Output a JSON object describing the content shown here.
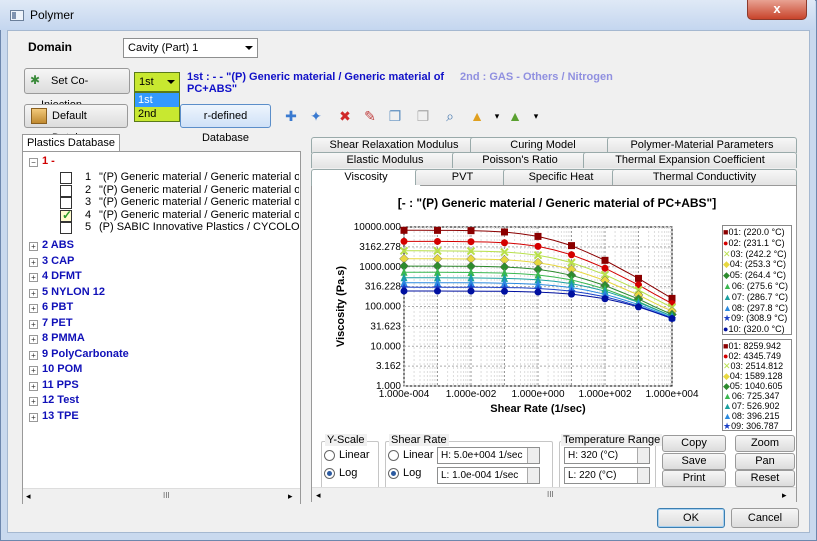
{
  "window": {
    "title": "Polymer",
    "close": "x"
  },
  "domain": {
    "label": "Domain",
    "value": "Cavity (Part) 1"
  },
  "coinj": {
    "button": "Set Co-Injection",
    "selected": "1st",
    "options": [
      "1st",
      "2nd"
    ],
    "first": "1st : - - \"(P)  Generic material / Generic material of",
    "first2": "PC+ABS\"",
    "second": "2nd : GAS - Others / Nitrogen"
  },
  "toolbar": {
    "default_db": "Default Database",
    "user_db": "r-defined Database"
  },
  "plastics": {
    "tab": "Plastics Database",
    "root": "1  -",
    "items": [
      {
        "n": "1",
        "t": "\"(P)  Generic material / Generic material of",
        "checked": false
      },
      {
        "n": "2",
        "t": "\"(P)  Generic material / Generic material of",
        "checked": false
      },
      {
        "n": "3",
        "t": "\"(P)  Generic material / Generic material of",
        "checked": false
      },
      {
        "n": "4",
        "t": "\"(P)  Generic material / Generic material of",
        "checked": true
      },
      {
        "n": "5",
        "t": "(P)  SABIC Innovative Plastics / CYCOLOY",
        "checked": false
      }
    ],
    "groups": [
      "2  ABS",
      "3  CAP",
      "4  DFMT",
      "5  NYLON 12",
      "6  PBT",
      "7  PET",
      "8  PMMA",
      "9  PolyCarbonate",
      "10  POM",
      "11  PPS",
      "12  Test",
      "13  TPE"
    ]
  },
  "tabs": {
    "row1": [
      "Shear Relaxation Modulus",
      "Curing Model",
      "Polymer-Material Parameters"
    ],
    "row2": [
      "Elastic Modulus",
      "Poisson's Ratio",
      "Thermal Expansion Coefficient"
    ],
    "row3": [
      "Viscosity",
      "PVT",
      "Specific Heat",
      "Thermal Conductivity"
    ]
  },
  "chart_data": {
    "type": "line",
    "title": "[- : \"(P)  Generic material / Generic material of PC+ABS\"]",
    "xlabel": "Shear Rate (1/sec)",
    "ylabel": "Viscosity (Pa.s)",
    "xscale": "log",
    "yscale": "log",
    "xlim": [
      0.0001,
      10000
    ],
    "ylim": [
      1,
      10000
    ],
    "xticks": [
      "1.000e-004",
      "1.000e-002",
      "1.000e+000",
      "1.000e+002",
      "1.000e+004"
    ],
    "yticks": [
      "10000.000",
      "3162.278",
      "1000.000",
      "316.228",
      "100.000",
      "31.623",
      "10.000",
      "3.162",
      "1.000"
    ],
    "x": [
      0.0001,
      0.0003,
      0.001,
      0.003,
      0.01,
      0.03,
      0.1,
      0.3,
      1,
      3,
      10,
      30,
      100,
      300,
      1000,
      3000,
      10000
    ],
    "series": [
      {
        "name": "01: (220.0 °C)",
        "color": "#8b0000",
        "marker": "square",
        "values": [
          8259.9,
          8250,
          8230,
          8190,
          8100,
          7900,
          7500,
          6800,
          5800,
          4600,
          3400,
          2300,
          1450,
          880,
          510,
          290,
          160
        ]
      },
      {
        "name": "02: (231.1 °C)",
        "color": "#d40000",
        "marker": "circle",
        "values": [
          4345.7,
          4340,
          4330,
          4310,
          4270,
          4190,
          4020,
          3720,
          3250,
          2650,
          2000,
          1400,
          920,
          580,
          350,
          205,
          118
        ]
      },
      {
        "name": "03: (242.2 °C)",
        "color": "#b8e04a",
        "marker": "x",
        "values": [
          2514.8,
          2512,
          2507,
          2497,
          2476,
          2432,
          2345,
          2190,
          1950,
          1630,
          1270,
          920,
          630,
          410,
          260,
          158,
          95
        ]
      },
      {
        "name": "04: (253.3 °C)",
        "color": "#e8d840",
        "marker": "diamond",
        "values": [
          1589.1,
          1588,
          1585,
          1579,
          1567,
          1542,
          1492,
          1403,
          1266,
          1080,
          860,
          640,
          450,
          300,
          195,
          122,
          76
        ]
      },
      {
        "name": "05: (264.4 °C)",
        "color": "#2e8b2e",
        "marker": "diamond",
        "values": [
          1040.6,
          1040,
          1038,
          1035,
          1028,
          1014,
          986,
          936,
          857,
          746,
          610,
          466,
          337,
          232,
          154,
          99,
          63
        ]
      },
      {
        "name": "06: (275.6 °C)",
        "color": "#3ab850",
        "marker": "triangle",
        "values": [
          725.3,
          725,
          724,
          722,
          718,
          710,
          694,
          666,
          620,
          553,
          466,
          368,
          275,
          195,
          133,
          88,
          57
        ]
      },
      {
        "name": "07: (286.7 °C)",
        "color": "#1aa0a0",
        "marker": "triangle",
        "values": [
          526.9,
          526.8,
          526.5,
          525.7,
          523.6,
          519.2,
          510.5,
          494.6,
          468.5,
          429.5,
          376.4,
          311.8,
          243.7,
          180.1,
          127,
          86.4,
          57
        ]
      },
      {
        "name": "08: (297.8 °C)",
        "color": "#2a8ae0",
        "marker": "triangle",
        "values": [
          396.2,
          396.1,
          395.9,
          395.4,
          394.2,
          391.6,
          386.4,
          376.7,
          360.2,
          334.8,
          299.1,
          253.5,
          203.1,
          154.3,
          112.1,
          78.7,
          53
        ]
      },
      {
        "name": "09: (308.9 °C)",
        "color": "#1a40c8",
        "marker": "star",
        "values": [
          306.8,
          306.7,
          306.6,
          306.3,
          305.5,
          303.9,
          300.7,
          294.6,
          284.1,
          267.7,
          244,
          212.3,
          175.5,
          137.4,
          102.3,
          73.4,
          51
        ]
      },
      {
        "name": "10: (320.0 °C)",
        "color": "#0010a0",
        "marker": "circle",
        "values": [
          245,
          244.9,
          244.9,
          244.7,
          244.2,
          243.2,
          241.2,
          237.4,
          230.8,
          220.2,
          204.5,
          182.8,
          156.2,
          126.8,
          97.5,
          71.4,
          50
        ]
      }
    ],
    "legend_temps": [
      "01: (220.0 °C)",
      "02: (231.1 °C)",
      "03: (242.2 °C)",
      "04: (253.3 °C)",
      "05: (264.4 °C)",
      "06: (275.6 °C)",
      "07: (286.7 °C)",
      "08: (297.8 °C)",
      "09: (308.9 °C)",
      "10: (320.0 °C)"
    ],
    "legend_zero": [
      "01: 8259.942",
      "02: 4345.749",
      "03: 2514.812",
      "04: 1589.128",
      "05: 1040.605",
      "06: 725.347",
      "07: 526.902",
      "08: 396.215",
      "09: 306.787"
    ]
  },
  "yscale": {
    "label": "Y-Scale",
    "linear": "Linear",
    "log": "Log"
  },
  "shear": {
    "label": "Shear Rate",
    "linear": "Linear",
    "log": "Log",
    "high": "H: 5.0e+004 1/sec",
    "low": "L: 1.0e-004 1/sec"
  },
  "temp": {
    "label": "Temperature Range",
    "high": "H: 320 (°C)",
    "low": "L: 220 (°C)"
  },
  "buttons": {
    "copy": "Copy",
    "save": "Save",
    "print": "Print",
    "zoom": "Zoom",
    "pan": "Pan",
    "reset": "Reset",
    "ok": "OK",
    "cancel": "Cancel"
  },
  "scroll": {
    "mid": "III"
  }
}
